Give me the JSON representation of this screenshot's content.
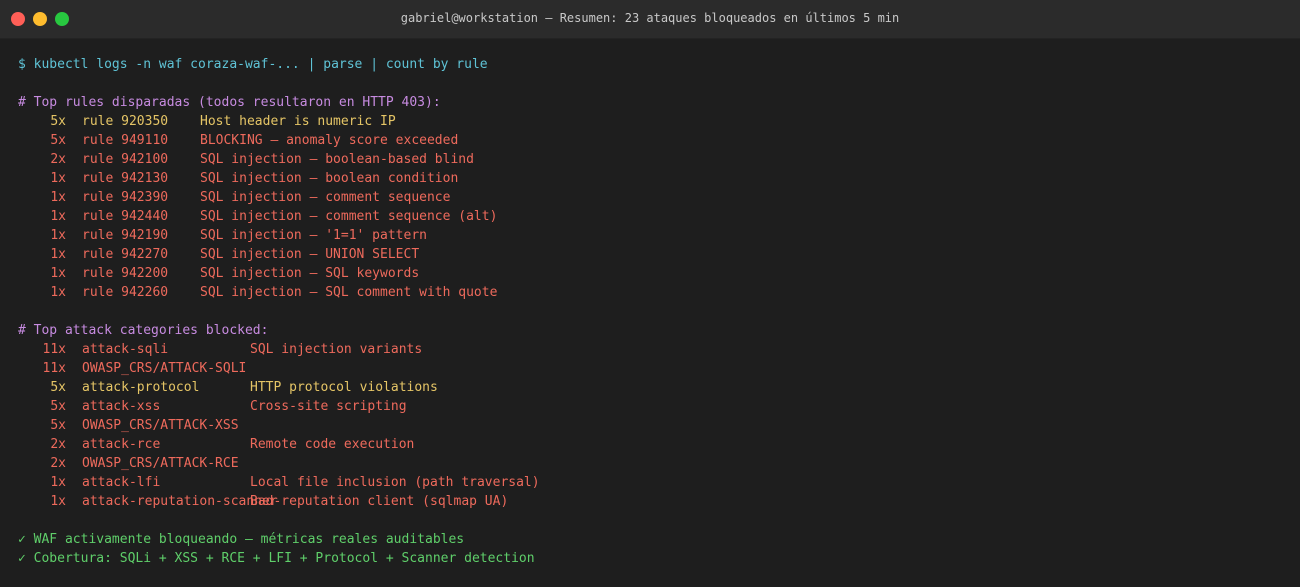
{
  "window": {
    "title": "gabriel@workstation — Resumen: 23 ataques bloqueados en últimos 5 min"
  },
  "colors": {
    "cmd": "#5fc3d6",
    "comment": "#c78be0",
    "yellow": "#e5c566",
    "red": "#ee6a5c",
    "green": "#5fcf6a"
  },
  "terminal": {
    "command": "$ kubectl logs -n waf coraza-waf-... | parse | count by rule",
    "rules_header": "# Top rules disparadas (todos resultaron en HTTP 403):",
    "rules": [
      {
        "count": "5x",
        "rule": "rule 920350",
        "desc": "Host header is numeric IP",
        "color": "yellow"
      },
      {
        "count": "5x",
        "rule": "rule 949110",
        "desc": "BLOCKING — anomaly score exceeded",
        "color": "red"
      },
      {
        "count": "2x",
        "rule": "rule 942100",
        "desc": "SQL injection — boolean-based blind",
        "color": "red"
      },
      {
        "count": "1x",
        "rule": "rule 942130",
        "desc": "SQL injection — boolean condition",
        "color": "red"
      },
      {
        "count": "1x",
        "rule": "rule 942390",
        "desc": "SQL injection — comment sequence",
        "color": "red"
      },
      {
        "count": "1x",
        "rule": "rule 942440",
        "desc": "SQL injection — comment sequence (alt)",
        "color": "red"
      },
      {
        "count": "1x",
        "rule": "rule 942190",
        "desc": "SQL injection — '1=1' pattern",
        "color": "red"
      },
      {
        "count": "1x",
        "rule": "rule 942270",
        "desc": "SQL injection — UNION SELECT",
        "color": "red"
      },
      {
        "count": "1x",
        "rule": "rule 942200",
        "desc": "SQL injection — SQL keywords",
        "color": "red"
      },
      {
        "count": "1x",
        "rule": "rule 942260",
        "desc": "SQL injection — SQL comment with quote",
        "color": "red"
      }
    ],
    "categories_header": "# Top attack categories blocked:",
    "categories": [
      {
        "count": "11x",
        "cat": "attack-sqli",
        "desc": "SQL injection variants",
        "color": "red"
      },
      {
        "count": "11x",
        "cat": "OWASP_CRS/ATTACK-SQLI",
        "desc": "",
        "color": "red"
      },
      {
        "count": "5x",
        "cat": "attack-protocol",
        "desc": "HTTP protocol violations",
        "color": "yellow"
      },
      {
        "count": "5x",
        "cat": "attack-xss",
        "desc": "Cross-site scripting",
        "color": "red"
      },
      {
        "count": "5x",
        "cat": "OWASP_CRS/ATTACK-XSS",
        "desc": "",
        "color": "red"
      },
      {
        "count": "2x",
        "cat": "attack-rce",
        "desc": "Remote code execution",
        "color": "red"
      },
      {
        "count": "2x",
        "cat": "OWASP_CRS/ATTACK-RCE",
        "desc": "",
        "color": "red"
      },
      {
        "count": "1x",
        "cat": "attack-lfi",
        "desc": "Local file inclusion (path traversal)",
        "color": "red"
      },
      {
        "count": "1x",
        "cat": "attack-reputation-scanner",
        "desc": "Bad-reputation client (sqlmap UA)",
        "color": "red"
      }
    ],
    "summary": [
      "✓ WAF activamente bloqueando — métricas reales auditables",
      "✓ Cobertura: SQLi + XSS + RCE + LFI + Protocol + Scanner detection"
    ]
  }
}
